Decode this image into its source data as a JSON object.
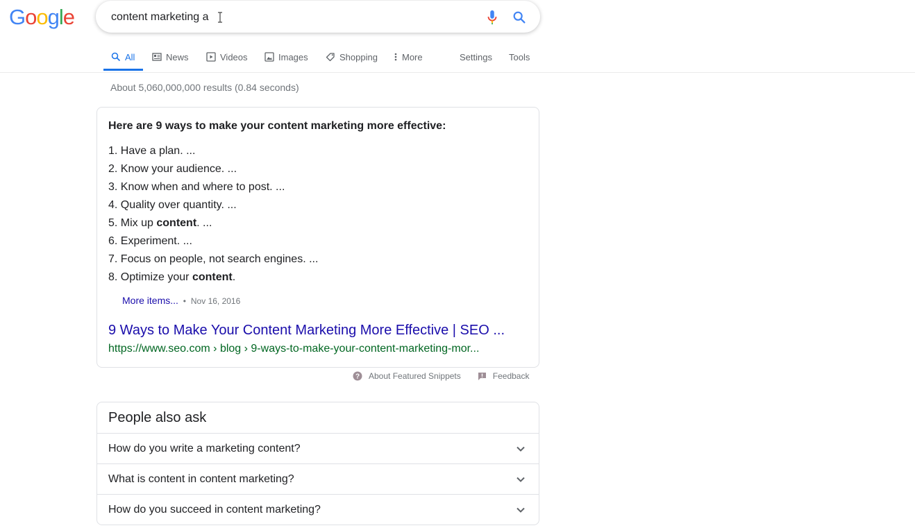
{
  "logo": {
    "letters": [
      {
        "ch": "G",
        "color": "#4285F4"
      },
      {
        "ch": "o",
        "color": "#EA4335"
      },
      {
        "ch": "o",
        "color": "#FBBC05"
      },
      {
        "ch": "g",
        "color": "#4285F4"
      },
      {
        "ch": "l",
        "color": "#34A853"
      },
      {
        "ch": "e",
        "color": "#EA4335"
      }
    ]
  },
  "search": {
    "query": "content marketing a"
  },
  "tabs": [
    {
      "label": "All",
      "icon": "search-icon"
    },
    {
      "label": "News",
      "icon": "news-icon"
    },
    {
      "label": "Videos",
      "icon": "video-icon"
    },
    {
      "label": "Images",
      "icon": "image-icon"
    },
    {
      "label": "Shopping",
      "icon": "tag-icon"
    },
    {
      "label": "More",
      "icon": "more-vert-icon"
    },
    {
      "label": "Settings"
    },
    {
      "label": "Tools"
    }
  ],
  "stats": "About 5,060,000,000 results (0.84 seconds)",
  "snippet": {
    "heading": "Here are 9 ways to make your content marketing more effective:",
    "items": [
      {
        "num": "1.",
        "pre": "Have a plan. ...",
        "bold": "",
        "post": ""
      },
      {
        "num": "2.",
        "pre": "Know your audience. ...",
        "bold": "",
        "post": ""
      },
      {
        "num": "3.",
        "pre": "Know when and where to post. ...",
        "bold": "",
        "post": ""
      },
      {
        "num": "4.",
        "pre": "Quality over quantity. ...",
        "bold": "",
        "post": ""
      },
      {
        "num": "5.",
        "pre": "Mix up ",
        "bold": "content",
        "post": ". ..."
      },
      {
        "num": "6.",
        "pre": "Experiment. ...",
        "bold": "",
        "post": ""
      },
      {
        "num": "7.",
        "pre": "Focus on people, not search engines. ...",
        "bold": "",
        "post": ""
      },
      {
        "num": "8.",
        "pre": "Optimize your ",
        "bold": "content",
        "post": "."
      }
    ],
    "more_items": "More items...",
    "separator": "•",
    "date": "Nov 16, 2016",
    "title": "9 Ways to Make Your Content Marketing More Effective | SEO ...",
    "url": "https://www.seo.com › blog › 9-ways-to-make-your-content-marketing-mor..."
  },
  "about": {
    "snippets_label": "About Featured Snippets",
    "feedback_label": "Feedback"
  },
  "paa": {
    "title": "People also ask",
    "questions": [
      "How do you write a marketing content?",
      "What is content in content marketing?",
      "How do you succeed in content marketing?"
    ]
  },
  "colors": {
    "link": "#1a0dab",
    "url": "#006621",
    "accent": "#1a73e8",
    "muted": "#70757a"
  }
}
